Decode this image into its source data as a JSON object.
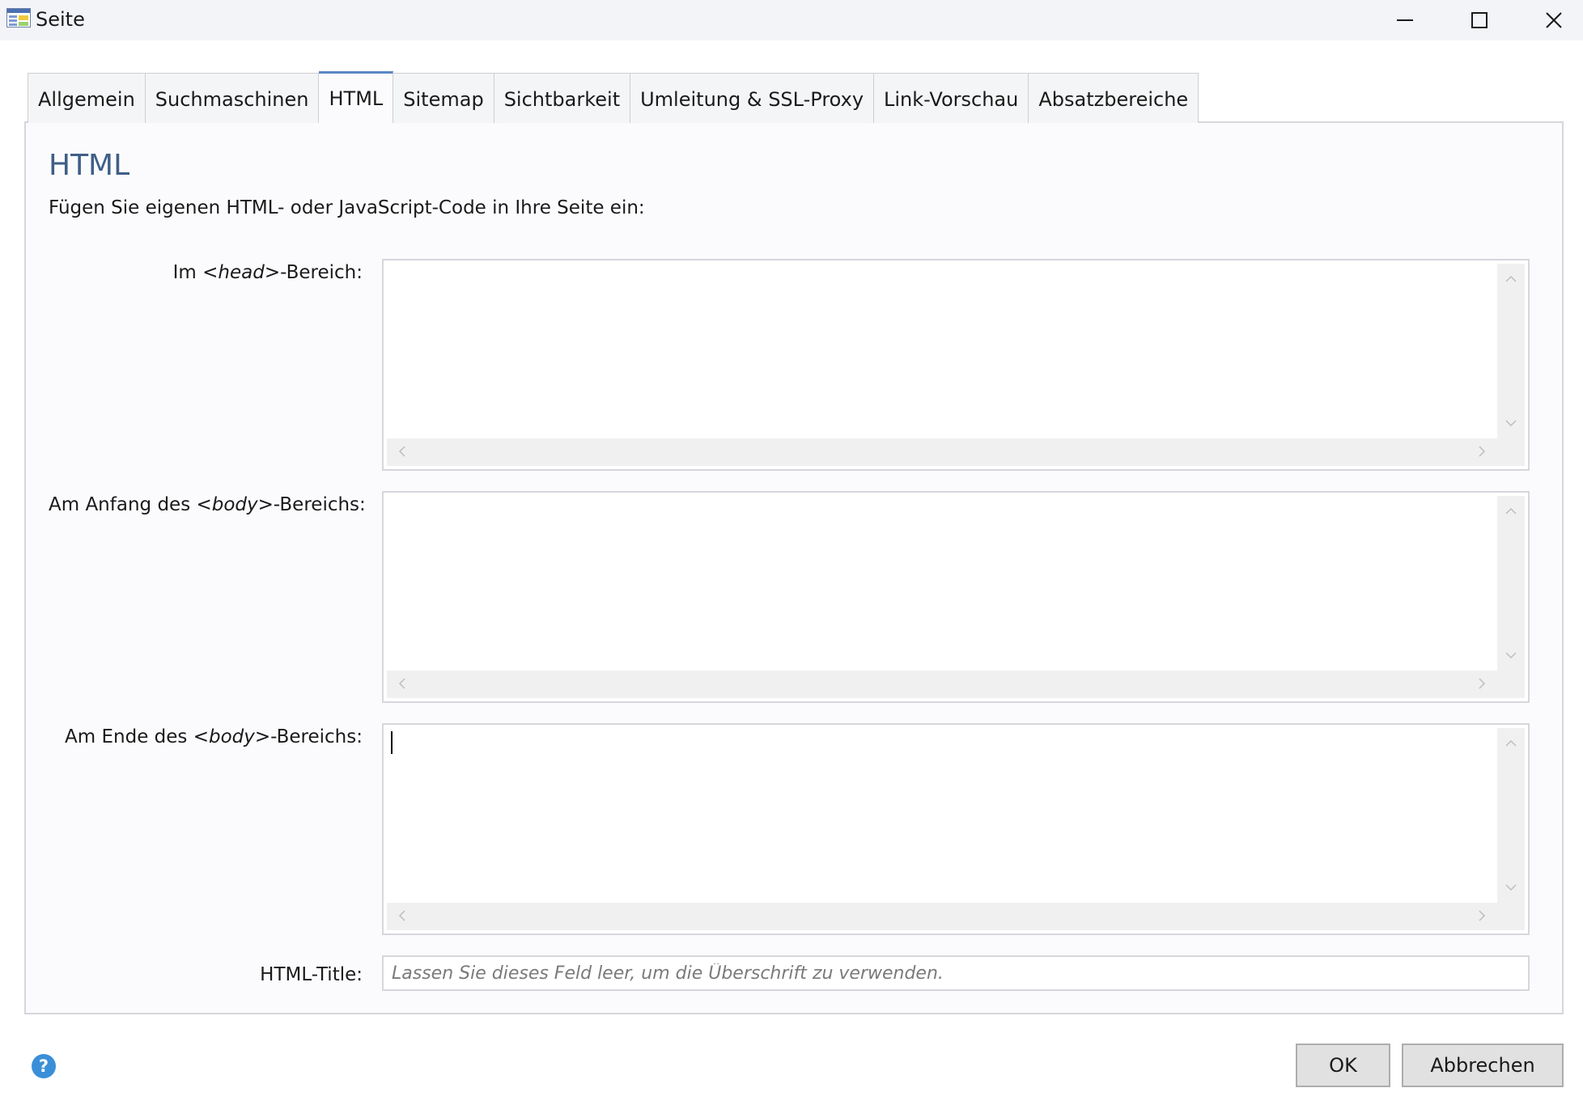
{
  "window": {
    "title": "Seite",
    "icon": "page-icon",
    "controls": [
      "minimize-icon",
      "maximize-icon",
      "close-icon"
    ]
  },
  "tabs": [
    {
      "label": "Allgemein",
      "active": false
    },
    {
      "label": "Suchmaschinen",
      "active": false
    },
    {
      "label": "HTML",
      "active": true
    },
    {
      "label": "Sitemap",
      "active": false
    },
    {
      "label": "Sichtbarkeit",
      "active": false
    },
    {
      "label": "Umleitung & SSL-Proxy",
      "active": false
    },
    {
      "label": "Link-Vorschau",
      "active": false
    },
    {
      "label": "Absatzbereiche",
      "active": false
    }
  ],
  "content": {
    "heading": "HTML",
    "intro": "Fügen Sie eigenen HTML- oder JavaScript-Code in Ihre Seite ein:",
    "head_field": {
      "label_prefix": "Im <",
      "label_tag": "head",
      "label_suffix": ">-Bereich:",
      "value": ""
    },
    "body_start_field": {
      "label_prefix": "Am Anfang des <",
      "label_tag": "body",
      "label_suffix": ">-Bereichs:",
      "value": ""
    },
    "body_end_field": {
      "label_prefix": "Am Ende des <",
      "label_tag": "body",
      "label_suffix": ">-Bereichs:",
      "value": ""
    },
    "html_title": {
      "label": "HTML-Title:",
      "value": "",
      "placeholder": "Lassen Sie dieses Feld leer, um die Überschrift zu verwenden."
    }
  },
  "footer": {
    "help_icon": "help-icon",
    "ok_label": "OK",
    "cancel_label": "Abbrechen"
  },
  "colors": {
    "heading": "#3e5f87",
    "active_tab_accent": "#5b86c4",
    "help_icon": "#3a8fd9",
    "button_bg": "#e1e1e1"
  }
}
